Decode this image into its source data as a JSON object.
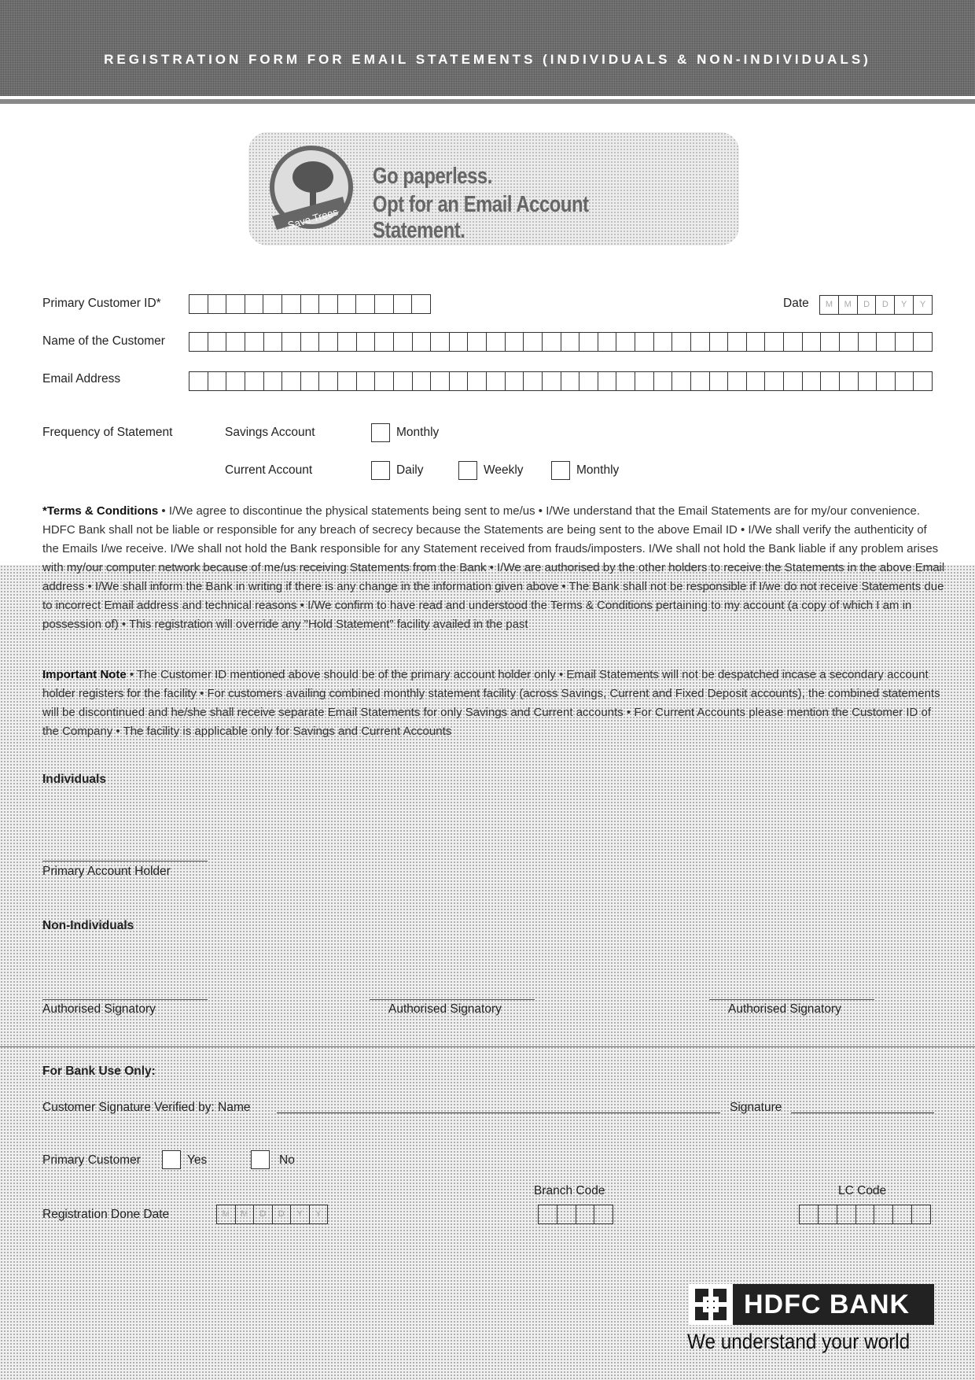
{
  "header": {
    "title": "REGISTRATION FORM FOR EMAIL STATEMENTS (INDIVIDUALS & NON-INDIVIDUALS)"
  },
  "promo": {
    "logo_text": "Save Trees",
    "line1": "Go paperless.",
    "line2": "Opt for an Email Account Statement."
  },
  "form": {
    "customer_id_label": "Primary Customer ID*",
    "date_label": "Date",
    "date_placeholders": [
      "M",
      "M",
      "D",
      "D",
      "Y",
      "Y"
    ],
    "name_label": "Name of the Customer",
    "email_label": "Email Address",
    "frequency_label": "Frequency of Statement",
    "savings_label": "Savings Account",
    "current_label": "Current Account",
    "savings_options": [
      "Monthly"
    ],
    "current_options": [
      "Daily",
      "Weekly",
      "Monthly"
    ]
  },
  "terms": {
    "heading": "*Terms & Conditions",
    "text": " • I/We agree to discontinue the physical statements being sent to me/us • I/We understand that the Email Statements are for my/our convenience. HDFC Bank shall not be liable or responsible for any breach of secrecy because the Statements are being sent to the above Email ID • I/We shall verify the authenticity of the Emails I/we receive. I/We shall not hold the Bank responsible for any Statement received from frauds/imposters. I/We shall not hold the Bank liable if any problem arises with my/our computer network because of me/us receiving Statements from the Bank • I/We are authorised by the other holders to receive the Statements in the above Email address • I/We shall inform the Bank in writing if there is any change in the information given above • The Bank shall not be responsible if I/we do not receive Statements due to incorrect Email address and technical reasons • I/We confirm to have read and understood the Terms & Conditions pertaining to my account (a copy of which I am in possession of) • This registration will override any \"Hold Statement\" facility availed in the past"
  },
  "note": {
    "heading": "Important Note",
    "text": " • The Customer ID mentioned above should be of the primary account holder only • Email Statements will not be despatched incase a secondary account holder registers for the facility • For customers availing combined monthly statement facility (across Savings, Current and Fixed Deposit accounts), the combined statements will be discontinued and he/she shall receive separate Email Statements for only Savings and Current accounts • For Current Accounts please mention the Customer ID of the Company • The facility is applicable only for Savings and Current Accounts"
  },
  "signatures": {
    "individuals_heading": "Individuals",
    "primary_holder": "Primary Account Holder",
    "non_individuals_heading": "Non-Individuals",
    "authorised": [
      "Authorised Signatory",
      "Authorised Signatory",
      "Authorised Signatory"
    ]
  },
  "bank_use": {
    "heading": "For Bank Use Only:",
    "verified_label": "Customer Signature Verified by: Name",
    "signature_label": "Signature",
    "primary_customer_label": "Primary Customer",
    "yes": "Yes",
    "no": "No",
    "branch_code_label": "Branch Code",
    "lc_code_label": "LC Code",
    "reg_date_label": "Registration Done Date",
    "reg_date_placeholders": [
      "M",
      "M",
      "D",
      "D",
      "Y",
      "Y"
    ]
  },
  "footer": {
    "brand": "HDFC BANK",
    "tagline": "We understand your world"
  }
}
